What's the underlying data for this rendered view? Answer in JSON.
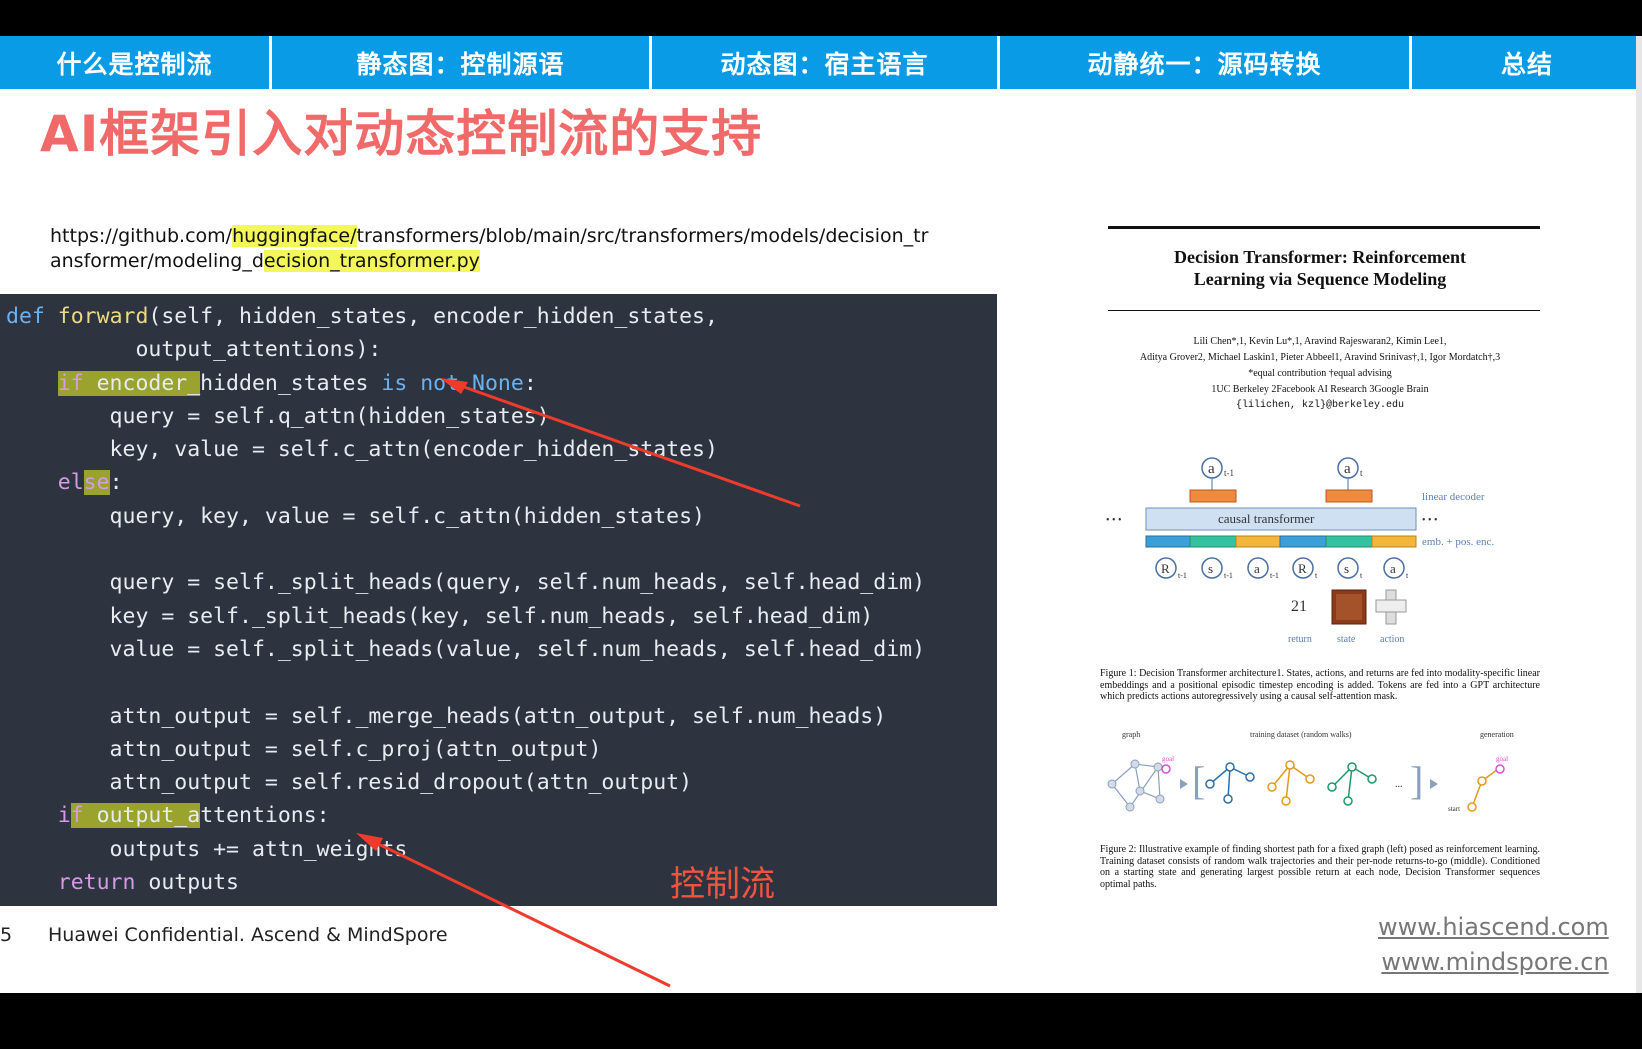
{
  "tabs": [
    "什么是控制流",
    "静态图：控制源语",
    "动态图：宿主语言",
    "动静统一：源码转换",
    "总结"
  ],
  "title": "AI框架引入对动态控制流的支持",
  "url": {
    "prefix": "https://github.com/",
    "hl1": "huggingface/",
    "mid": "transformers/blob/main/src/transformers/models/decision_tr",
    "line2a": "ansformer/modeling_d",
    "hl2": "ecision_transformer.py"
  },
  "annotation": "控制流",
  "footer": "Huawei Confidential. Ascend & MindSpore",
  "page_number": "5",
  "links": [
    "www.hiascend.com",
    "www.mindspore.cn"
  ],
  "paper": {
    "title_line1": "Decision Transformer: Reinforcement",
    "title_line2": "Learning via Sequence Modeling",
    "authors_line1": "Lili Chen*,1, Kevin Lu*,1, Aravind Rajeswaran2, Kimin Lee1,",
    "authors_line2": "Aditya Grover2, Michael Laskin1, Pieter Abbeel1, Aravind Srinivas†,1, Igor Mordatch†,3",
    "authors_line3": "*equal contribution   †equal advising",
    "authors_line4": "1UC Berkeley   2Facebook AI Research   3Google Brain",
    "authors_line5": "{lilichen, kzl}@berkeley.edu",
    "fig1_caption": "Figure 1:  Decision Transformer architecture1. States, actions, and returns are fed into modality-specific linear embeddings and a positional episodic timestep encoding is added. Tokens are fed into a GPT architecture which predicts actions autoregressively using a causal self-attention mask.",
    "fig2_caption": "Figure 2:  Illustrative example of finding shortest path for a fixed graph (left) posed as reinforcement learning. Training dataset consists of random walk trajectories and their per-node returns-to-go (middle). Conditioned on a starting state and generating largest possible return at each node, Decision Transformer sequences optimal paths.",
    "diagram": {
      "causal": "causal transformer",
      "linear_decoder": "linear decoder",
      "emb": "emb. + pos. enc.",
      "return_label": "return",
      "state_label": "state",
      "action_label": "action",
      "return_value": "21",
      "dots": "• • •",
      "a": "a",
      "r": "R",
      "s": "s",
      "t1": "t-1",
      "t": "t"
    },
    "graph_labels": {
      "graph": "graph",
      "training": "training dataset (random walks)",
      "generation": "generation",
      "goal": "goal",
      "start": "start",
      "ellipsis": "..."
    }
  }
}
